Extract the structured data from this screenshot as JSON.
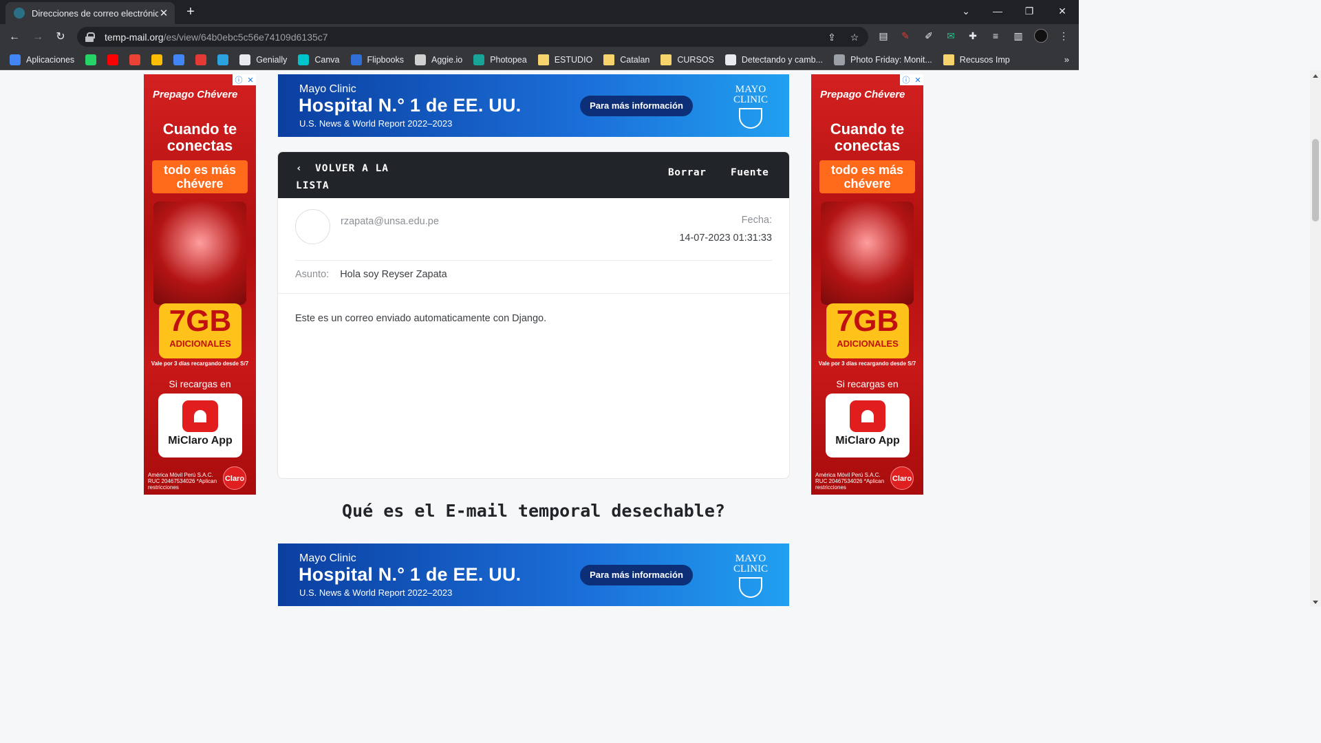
{
  "browser": {
    "tab_title": "Direcciones de correo electrónico",
    "tab_close": "✕",
    "new_tab": "+",
    "url_host": "temp-mail.org",
    "url_path": "/es/view/64b0ebc5c56e74109d6135c7",
    "window_controls": {
      "tabsearch": "⌄",
      "minimize": "—",
      "restore": "❐",
      "close": "✕"
    },
    "nav": {
      "back": "←",
      "forward": "→",
      "reload": "↻"
    }
  },
  "bookmarks": {
    "items": [
      {
        "label": "Aplicaciones",
        "icon": "apps-grid-icon",
        "color": "#4285f4"
      },
      {
        "label": "",
        "icon": "whatsapp-icon",
        "color": "#25d366"
      },
      {
        "label": "",
        "icon": "youtube-icon",
        "color": "#ff0000"
      },
      {
        "label": "",
        "icon": "gmail-icon",
        "color": "#ea4335"
      },
      {
        "label": "",
        "icon": "drive-icon",
        "color": "#fbbc04"
      },
      {
        "label": "",
        "icon": "translate-icon",
        "color": "#4285f4"
      },
      {
        "label": "",
        "icon": "symbaloo-icon",
        "color": "#e53935"
      },
      {
        "label": "",
        "icon": "telegram-icon",
        "color": "#2aa3df"
      },
      {
        "label": "Genially",
        "icon": "genially-icon",
        "color": "#e8eaed"
      },
      {
        "label": "Canva",
        "icon": "canva-icon",
        "color": "#00c4cc"
      },
      {
        "label": "Flipbooks",
        "icon": "flipbooks-icon",
        "color": "#2f6fd6"
      },
      {
        "label": "Aggie.io",
        "icon": "aggie-icon",
        "color": "#d0d0d0"
      },
      {
        "label": "Photopea",
        "icon": "photopea-icon",
        "color": "#18a497"
      },
      {
        "label": "ESTUDIO",
        "icon": "folder-icon",
        "color": "#f6d36b"
      },
      {
        "label": "Catalan",
        "icon": "folder-icon",
        "color": "#f6d36b"
      },
      {
        "label": "CURSOS",
        "icon": "folder-icon",
        "color": "#f6d36b"
      },
      {
        "label": "Detectando y camb...",
        "icon": "jw-icon",
        "color": "#e8eaed"
      },
      {
        "label": "Photo Friday: Monit...",
        "icon": "page-icon",
        "color": "#9aa0a6"
      },
      {
        "label": "Recusos Imp",
        "icon": "folder-icon",
        "color": "#f6d36b"
      }
    ],
    "more": "»"
  },
  "ads": {
    "banner": {
      "line1": "Mayo Clinic",
      "line2": "Hospital N.° 1 de EE. UU.",
      "line3": "U.S. News & World Report 2022–2023",
      "cta": "Para más información",
      "logo": "MAYO CLINIC"
    },
    "side": {
      "brand": "Prepago Chévere",
      "headline": "Cuando te conectas",
      "pill": "todo es más chévere",
      "gb": "7GB",
      "gb_sub": "ADICIONALES",
      "fine": "Vale por 3 días recargando desde S/7",
      "recargas": "Si recargas en",
      "app": "MiClaro App",
      "legal": "América Móvil Perú S.A.C. RUC 20467534026 *Aplican restricciones",
      "claro": "Claro"
    }
  },
  "email": {
    "back_label": "VOLVER A LA LISTA",
    "delete_label": "Borrar",
    "source_label": "Fuente",
    "sender": "rzapata@unsa.edu.pe",
    "date_label": "Fecha:",
    "date_value": "14-07-2023 01:31:33",
    "subject_label": "Asunto:",
    "subject_value": "Hola soy Reyser Zapata",
    "body": "Este es un correo enviado automaticamente con Django."
  },
  "section": {
    "title": "Qué es el E-mail temporal desechable?"
  }
}
